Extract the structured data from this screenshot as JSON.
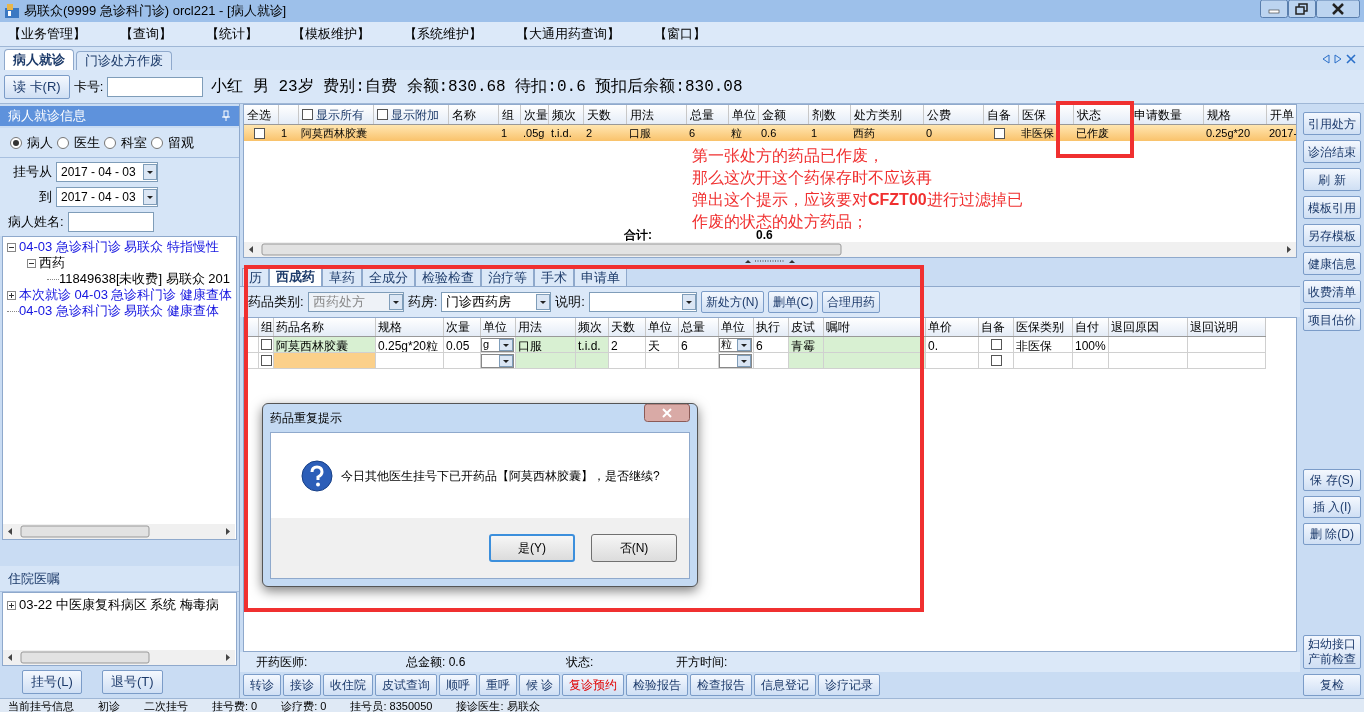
{
  "window": {
    "title": "易联众(9999 急诊科门诊) orcl221 - [病人就诊]"
  },
  "menu": [
    "【业务管理】",
    "【查询】",
    "【统计】",
    "【模板维护】",
    "【系统维护】",
    "【大通用药查询】",
    "【窗口】"
  ],
  "doc_tabs": [
    {
      "label": "病人就诊",
      "selected": true
    },
    {
      "label": "门诊处方作废",
      "selected": false
    }
  ],
  "patient_bar": {
    "read_card_button": "读 卡(R)",
    "card_label": "卡号:",
    "summary": "小红 男 23岁 费别:自费 余额:830.68 待扣:0.6 预扣后余额:830.08"
  },
  "left_panel": {
    "title": "病人就诊信息",
    "filter": [
      {
        "label": "病人",
        "selected": true
      },
      {
        "label": "医生",
        "selected": false
      },
      {
        "label": "科室",
        "selected": false
      },
      {
        "label": "留观",
        "selected": false
      }
    ],
    "from_label": "挂号从",
    "from_date": "2017 - 04 - 03",
    "to_label": "到",
    "to_date": "2017 - 04 - 03",
    "name_label": "病人姓名:",
    "tree": [
      {
        "text": "04-03 急诊科门诊 易联众 特指慢性",
        "expanded": true,
        "children": [
          {
            "text": "西药",
            "expanded": true,
            "children": [
              {
                "text": "11849638[未收费] 易联众 201"
              }
            ]
          }
        ]
      },
      {
        "text": "本次就诊 04-03 急诊科门诊 健康查体",
        "expanded": false
      },
      {
        "text": "04-03 急诊科门诊 易联众 健康查体"
      }
    ],
    "inpatient_title": "住院医嘱",
    "inpatient_tree": [
      {
        "text": "03-22 中医康复科病区 系统 梅毒病",
        "expanded": false
      }
    ],
    "buttons": [
      "挂号(L)",
      "退号(T)"
    ]
  },
  "upper_grid": {
    "columns": [
      {
        "kind": "label",
        "label": "全选"
      },
      {
        "kind": "blank"
      },
      {
        "kind": "toggle",
        "label": "显示所有",
        "checked": false
      },
      {
        "kind": "toggle",
        "label": "显示附加",
        "checked": false
      },
      {
        "kind": "label",
        "label": "名称"
      },
      {
        "kind": "label",
        "label": "组"
      },
      {
        "kind": "label",
        "label": "次量"
      },
      {
        "kind": "label",
        "label": "频次"
      },
      {
        "kind": "label",
        "label": "天数"
      },
      {
        "kind": "label",
        "label": "用法"
      },
      {
        "kind": "label",
        "label": "总量"
      },
      {
        "kind": "label",
        "label": "单位"
      },
      {
        "kind": "label",
        "label": "金额"
      },
      {
        "kind": "label",
        "label": "剂数"
      },
      {
        "kind": "label",
        "label": "处方类别"
      },
      {
        "kind": "label",
        "label": "公费"
      },
      {
        "kind": "label",
        "label": "自备"
      },
      {
        "kind": "label",
        "label": "医保"
      },
      {
        "kind": "label",
        "label": "状态"
      },
      {
        "kind": "label",
        "label": "申请数量"
      },
      {
        "kind": "label",
        "label": "规格"
      },
      {
        "kind": "label",
        "label": "开单"
      }
    ],
    "rows": [
      {
        "selected": true,
        "cells": [
          {
            "kind": "check",
            "checked": false
          },
          {
            "text": "1"
          },
          {
            "text": "阿莫西林胶囊"
          },
          {
            "kind": "empty"
          },
          {
            "kind": "empty"
          },
          {
            "text": "1"
          },
          {
            "text": ".05g"
          },
          {
            "text": "t.i.d."
          },
          {
            "text": "2"
          },
          {
            "text": "口服"
          },
          {
            "text": "6"
          },
          {
            "text": "粒"
          },
          {
            "text": "0.6"
          },
          {
            "text": "1"
          },
          {
            "text": "西药"
          },
          {
            "text": "0"
          },
          {
            "kind": "check",
            "checked": false
          },
          {
            "text": "非医保"
          },
          {
            "text": "已作废"
          },
          {
            "kind": "empty"
          },
          {
            "text": "0.25g*20"
          },
          {
            "text": "2017-"
          }
        ]
      }
    ],
    "total_label": "合计:",
    "total_value": "0.6"
  },
  "note": {
    "lines": [
      "第一张处方的药品已作废，",
      "那么这次开这个药保存时不应该再",
      "弹出这个提示，应该要对**CFZT00**进行过滤掉已",
      "作废的状态的处方药品；"
    ]
  },
  "lower_tabs": [
    {
      "label": "历",
      "selected": false
    },
    {
      "label": "西成药",
      "selected": true
    },
    {
      "label": "草药",
      "selected": false
    },
    {
      "label": "全成分",
      "selected": false
    },
    {
      "label": "检验检查",
      "selected": false
    },
    {
      "label": "治疗等",
      "selected": false
    },
    {
      "label": "手术",
      "selected": false
    },
    {
      "label": "申请单",
      "selected": false
    }
  ],
  "toolbar": {
    "category_label": "药品类别:",
    "category": {
      "value": "西药处方",
      "disabled": true
    },
    "pharmacy_label": "药房:",
    "pharmacy": {
      "value": "门诊西药房",
      "disabled": false
    },
    "note_label": "说明:",
    "buttons": [
      "新处方(N)",
      "删单(C)",
      "合理用药"
    ]
  },
  "lower_grid": {
    "columns": [
      {
        "label": "组"
      },
      {
        "label": "药品名称",
        "shaded": true
      },
      {
        "label": "规格"
      },
      {
        "label": "次量"
      },
      {
        "label": "单位"
      },
      {
        "label": "用法",
        "shaded": true
      },
      {
        "label": "频次",
        "shaded": true
      },
      {
        "label": "天数"
      },
      {
        "label": "单位"
      },
      {
        "label": "总量"
      },
      {
        "label": "单位"
      },
      {
        "label": "执行"
      },
      {
        "label": "皮试",
        "shaded": true
      },
      {
        "label": "嘱咐",
        "shaded": true
      },
      {
        "label": "单价"
      },
      {
        "label": "自备"
      },
      {
        "label": "医保类别"
      },
      {
        "label": "自付"
      },
      {
        "label": "退回原因"
      },
      {
        "label": "退回说明"
      }
    ],
    "rows": [
      {
        "cells": [
          {
            "kind": "check",
            "checked": false
          },
          {
            "text": "阿莫西林胶囊"
          },
          {
            "text": "0.25g*20粒"
          },
          {
            "text": "0.05"
          },
          {
            "kind": "select",
            "text": "g"
          },
          {
            "text": "口服"
          },
          {
            "text": "t.i.d."
          },
          {
            "text": "2"
          },
          {
            "text": "天"
          },
          {
            "text": "6"
          },
          {
            "kind": "select",
            "text": "粒"
          },
          {
            "text": "6"
          },
          {
            "text": "青霉"
          },
          {
            "kind": "empty"
          },
          {
            "text": "0."
          },
          {
            "kind": "check",
            "checked": false
          },
          {
            "text": "非医保"
          },
          {
            "text": "100%"
          },
          {
            "kind": "empty"
          },
          {
            "kind": "empty"
          }
        ]
      },
      {
        "cells": [
          {
            "kind": "check",
            "checked": false
          },
          {
            "kind": "empty",
            "focused": true
          },
          {
            "kind": "empty"
          },
          {
            "kind": "empty"
          },
          {
            "kind": "select"
          },
          {
            "kind": "empty"
          },
          {
            "kind": "empty"
          },
          {
            "kind": "empty"
          },
          {
            "kind": "empty"
          },
          {
            "kind": "empty"
          },
          {
            "kind": "select"
          },
          {
            "kind": "empty"
          },
          {
            "kind": "empty"
          },
          {
            "kind": "empty"
          },
          {
            "kind": "empty"
          },
          {
            "kind": "check",
            "checked": false
          },
          {
            "kind": "empty"
          },
          {
            "kind": "empty"
          },
          {
            "kind": "empty"
          },
          {
            "kind": "empty"
          }
        ]
      }
    ]
  },
  "dialog": {
    "title": "药品重复提示",
    "message": "今日其他医生挂号下已开药品【阿莫西林胶囊】，是否继续?",
    "buttons": [
      {
        "label": "是(Y)",
        "default": true
      },
      {
        "label": "否(N)",
        "default": false
      }
    ]
  },
  "footer_info": [
    "开药医师:",
    "总金额: 0.6",
    "状态:",
    "开方时间:"
  ],
  "action_buttons": [
    {
      "label": "转诊",
      "alert": false
    },
    {
      "label": "接诊",
      "alert": false
    },
    {
      "label": "收住院",
      "alert": false
    },
    {
      "label": "皮试查询",
      "alert": false
    },
    {
      "label": "顺呼",
      "alert": false
    },
    {
      "label": "重呼",
      "alert": false
    },
    {
      "label": "候 诊",
      "alert": false
    },
    {
      "label": "复诊预约",
      "alert": true
    },
    {
      "label": "检验报告",
      "alert": false
    },
    {
      "label": "检查报告",
      "alert": false
    },
    {
      "label": "信息登记",
      "alert": false
    },
    {
      "label": "诊疗记录",
      "alert": false
    }
  ],
  "side_buttons_top": [
    "引用处方",
    "诊治结束",
    "刷 新",
    "模板引用",
    "另存模板",
    "健康信息",
    "收费清单",
    "项目估价"
  ],
  "side_buttons_middle": [
    "保 存(S)",
    "插 入(I)",
    "删 除(D)"
  ],
  "side_buttons_bottom": [
    "妇幼接口产前检查",
    "复检"
  ],
  "status_bar": [
    "当前挂号信息",
    "初诊",
    "二次挂号",
    "挂号费: 0",
    "诊疗费: 0",
    "挂号员: 8350050",
    "接诊医生: 易联众"
  ]
}
